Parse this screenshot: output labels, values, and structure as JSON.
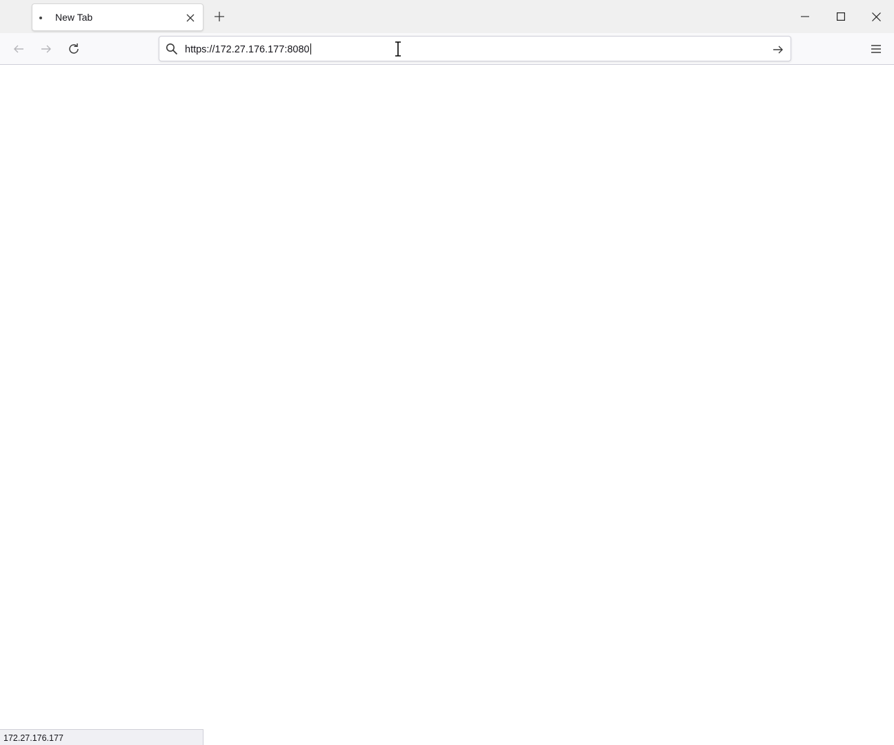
{
  "tab": {
    "title": "New Tab",
    "favicon": "dot-icon",
    "close_icon": "close-icon"
  },
  "toolbar": {
    "new_tab_icon": "plus-icon",
    "back_icon": "arrow-left-icon",
    "forward_icon": "arrow-right-icon",
    "reload_icon": "reload-icon",
    "menu_icon": "hamburger-menu-icon"
  },
  "window_controls": {
    "minimize_icon": "minimize-icon",
    "maximize_icon": "maximize-icon",
    "close_icon": "close-icon"
  },
  "urlbar": {
    "search_icon": "search-icon",
    "value": "https://172.27.176.177:8080",
    "go_icon": "arrow-right-icon"
  },
  "status": {
    "text": "172.27.176.177"
  },
  "colors": {
    "titlebar_bg": "#f0f0f0",
    "toolbar_bg": "#f9f9fb",
    "text": "#15141a"
  }
}
